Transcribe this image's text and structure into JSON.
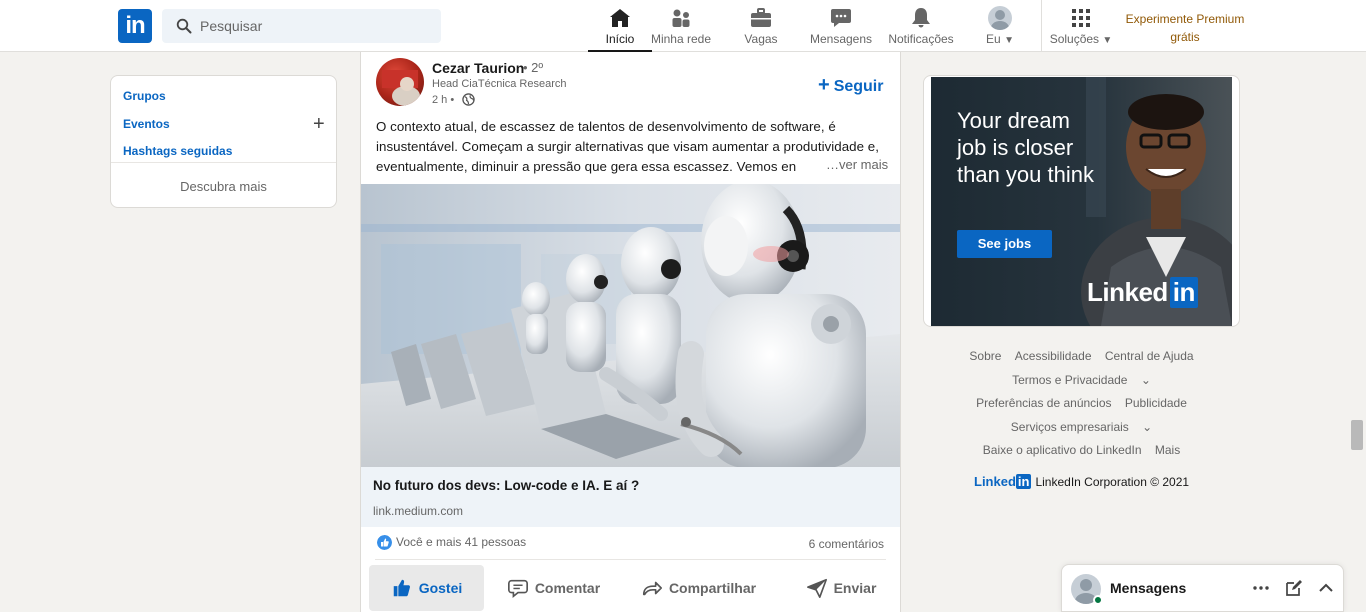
{
  "nav": {
    "logo": "in",
    "search_placeholder": "Pesquisar",
    "items": [
      {
        "label": "Início",
        "icon": "home-icon"
      },
      {
        "label": "Minha rede",
        "icon": "network-icon"
      },
      {
        "label": "Vagas",
        "icon": "briefcase-icon"
      },
      {
        "label": "Mensagens",
        "icon": "messaging-icon"
      },
      {
        "label": "Notificações",
        "icon": "bell-icon"
      },
      {
        "label": "Eu",
        "icon": "avatar"
      },
      {
        "label": "Soluções",
        "icon": "grid-icon"
      }
    ],
    "premium_line1": "Experimente Premium",
    "premium_line2": "grátis"
  },
  "left": {
    "groups": "Grupos",
    "events": "Eventos",
    "hashtags": "Hashtags seguidas",
    "discover": "Descubra mais"
  },
  "post": {
    "author": "Cezar Taurion",
    "degree": "• 2º",
    "headline": "Head CiaTécnica Research",
    "time": "2 h •",
    "follow": "Seguir",
    "text": "O contexto atual, de escassez de talentos de desenvolvimento de software, é insustentável. Começam a surgir alternativas que visam aumentar a produtividade e, eventualmente, diminuir a pressão que gera essa escassez. Vemos en",
    "see_more": "…ver mais",
    "link_title": "No futuro dos devs: Low-code e IA. E aí ?",
    "link_domain": "link.medium.com",
    "reactions": "Você e mais 41 pessoas",
    "comments": "6 comentários",
    "actions": {
      "like": "Gostei",
      "comment": "Comentar",
      "share": "Compartilhar",
      "send": "Enviar"
    }
  },
  "ad": {
    "headline": "Your dream job is closer than you think",
    "cta": "See jobs",
    "brand_text": "Linked",
    "brand_in": "in"
  },
  "footer": {
    "links": [
      "Sobre",
      "Acessibilidade",
      "Central de Ajuda",
      "Termos e Privacidade",
      "Preferências de anúncios",
      "Publicidade",
      "Serviços empresariais",
      "Baixe o aplicativo do LinkedIn",
      "Mais"
    ],
    "brand_text": "Linked",
    "brand_in": "in",
    "copyright": "LinkedIn Corporation © 2021"
  },
  "messaging": {
    "label": "Mensagens"
  },
  "colors": {
    "brand": "#0a66c2",
    "premium": "#915907",
    "background": "#f3f2ef"
  }
}
